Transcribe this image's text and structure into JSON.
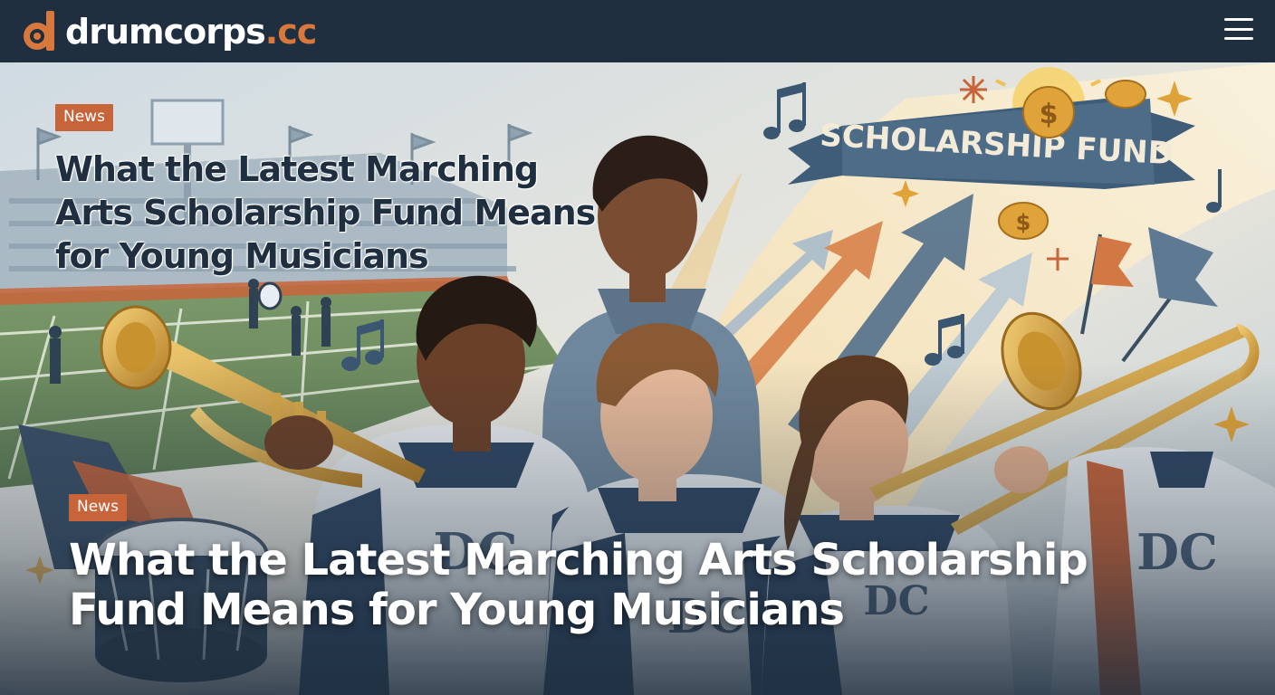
{
  "header": {
    "logo_main": "drumcorps",
    "logo_tld": ".cc",
    "menu_icon": "hamburger-menu-icon"
  },
  "hero": {
    "banner_text": "SCHOLARSHIP FUND",
    "uniform_monogram": "DC",
    "upper_category": "News",
    "upper_title": "What the Latest Marching Arts Scholarship Fund Means for Young Musicians",
    "category": "News",
    "title": "What the Latest Marching Arts Scholarship Fund Means for Young Musicians"
  },
  "colors": {
    "header_bg": "#1f2f40",
    "accent_orange": "#d8783c",
    "badge_bg": "#c8643a",
    "navy": "#2f4a66",
    "gold": "#e0a33a"
  }
}
